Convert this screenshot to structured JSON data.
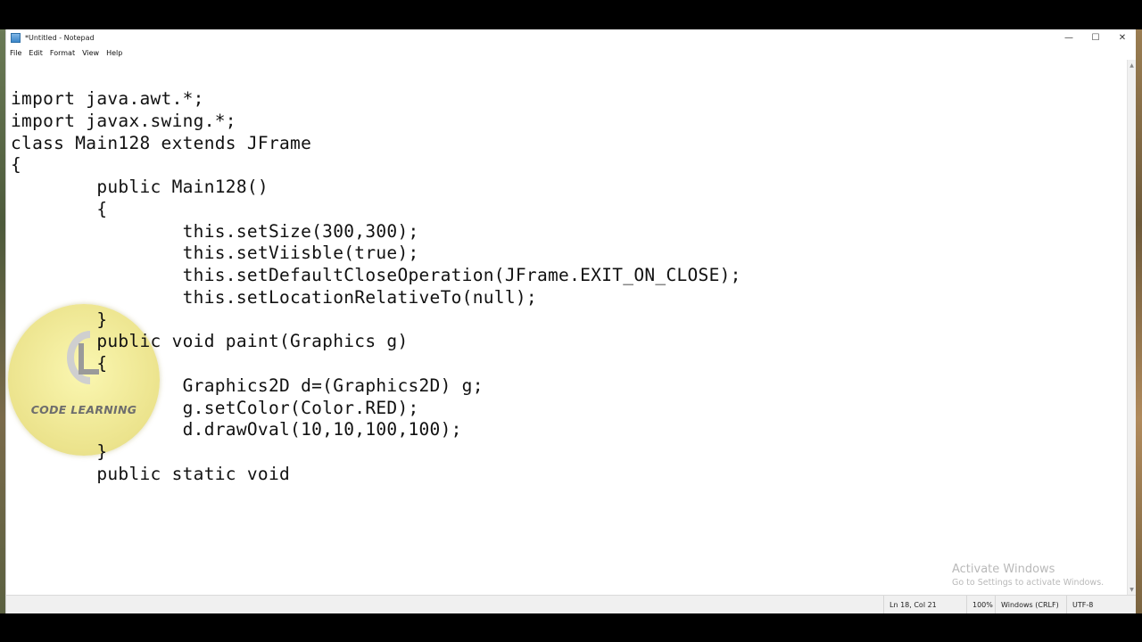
{
  "window": {
    "title": "*Untitled - Notepad",
    "controls": {
      "minimize": "—",
      "maximize": "☐",
      "close": "✕"
    }
  },
  "menu": [
    "File",
    "Edit",
    "Format",
    "View",
    "Help"
  ],
  "editor": {
    "lines": [
      "import java.awt.*;",
      "import javax.swing.*;",
      "class Main128 extends JFrame",
      "{",
      "        public Main128()",
      "        {",
      "                this.setSize(300,300);",
      "                this.setViisble(true);",
      "                this.setDefaultCloseOperation(JFrame.EXIT_ON_CLOSE);",
      "                this.setLocationRelativeTo(null);",
      "        }",
      "        public void paint(Graphics g)",
      "        {",
      "                Graphics2D d=(Graphics2D) g;",
      "                g.setColor(Color.RED);",
      "                d.drawOval(10,10,100,100);",
      "        }",
      "        public static void"
    ]
  },
  "status": {
    "position": "Ln 18, Col 21",
    "zoom": "100%",
    "line_ending": "Windows (CRLF)",
    "encoding": "UTF-8"
  },
  "activation": {
    "title": "Activate Windows",
    "subtitle": "Go to Settings to activate Windows."
  },
  "watermark": {
    "text": "CODE LEARNING",
    "logo_letters": "CL"
  }
}
